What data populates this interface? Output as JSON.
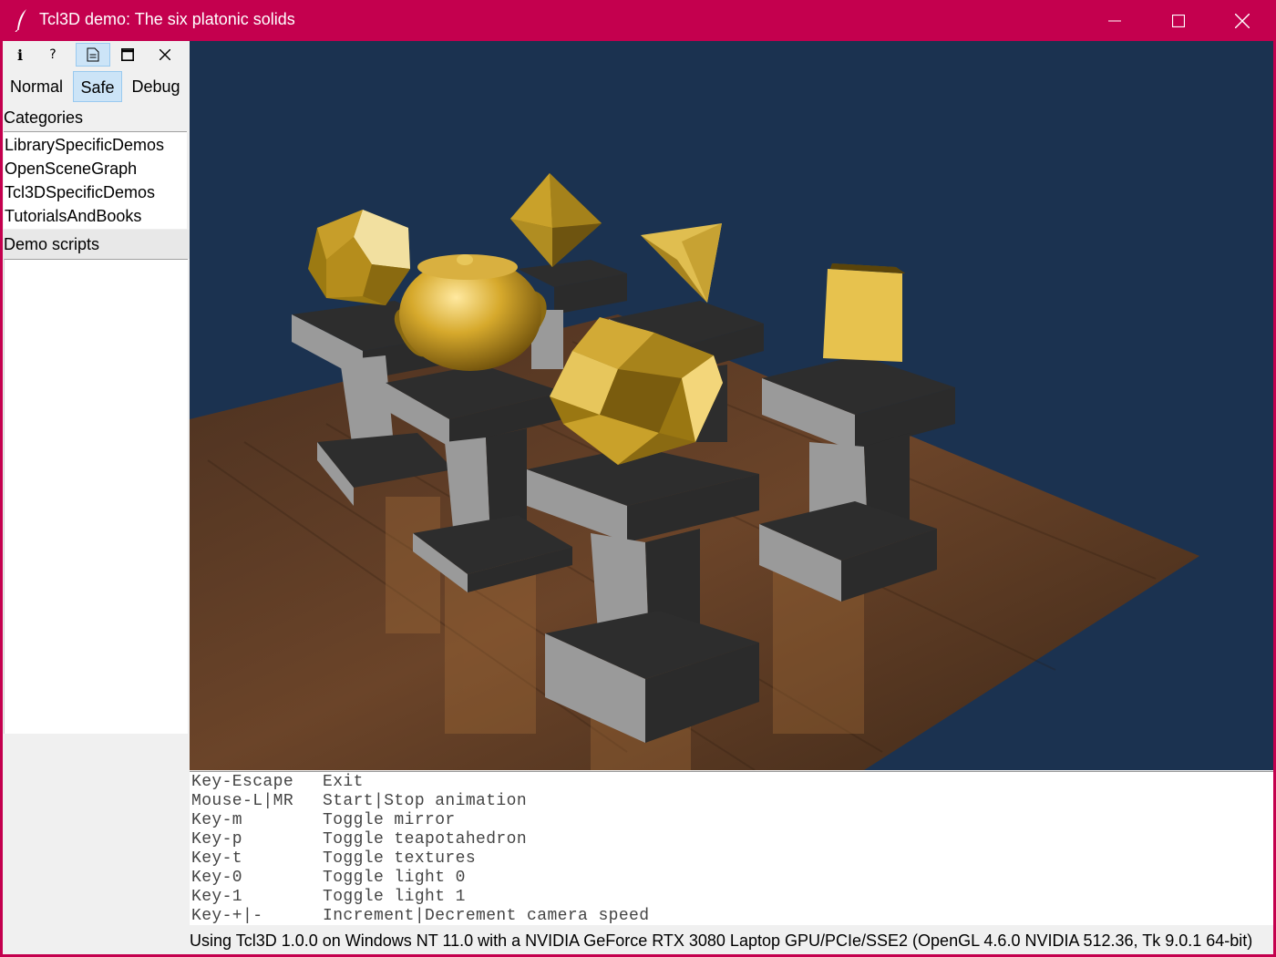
{
  "window": {
    "title": "Tcl3D demo: The six platonic solids",
    "controls": {
      "minimize": "minimize-icon",
      "maximize": "maximize-icon",
      "close": "close-icon"
    }
  },
  "toolbar": {
    "buttons": [
      {
        "icon": "info-icon",
        "glyph": "i"
      },
      {
        "icon": "help-icon",
        "glyph": "?"
      },
      {
        "icon": "document-icon",
        "glyph": "🗎",
        "active": true
      },
      {
        "icon": "window-icon",
        "glyph": "🗖"
      },
      {
        "icon": "close-icon",
        "glyph": "✕"
      }
    ]
  },
  "modes": [
    {
      "label": "Normal",
      "active": false
    },
    {
      "label": "Safe",
      "active": true
    },
    {
      "label": "Debug",
      "active": false
    }
  ],
  "categories": {
    "label": "Categories",
    "items": [
      "LibrarySpecificDemos",
      "OpenSceneGraph",
      "Tcl3DSpecificDemos",
      "TutorialsAndBooks"
    ]
  },
  "scripts": {
    "label": "Demo scripts",
    "items": []
  },
  "help": [
    {
      "key": "Key-Escape",
      "desc": "Exit"
    },
    {
      "key": "Mouse-L|MR",
      "desc": "Start|Stop animation"
    },
    {
      "key": "Key-m",
      "desc": "Toggle mirror"
    },
    {
      "key": "Key-p",
      "desc": "Toggle teapotahedron"
    },
    {
      "key": "Key-t",
      "desc": "Toggle textures"
    },
    {
      "key": "Key-0",
      "desc": "Toggle light 0"
    },
    {
      "key": "Key-1",
      "desc": "Toggle light 1"
    },
    {
      "key": "Key-+|-",
      "desc": "Increment|Decrement camera speed"
    }
  ],
  "status": "Using Tcl3D 1.0.0 on Windows NT 11.0 with a NVIDIA GeForce RTX 3080 Laptop GPU/PCIe/SSE2 (OpenGL 4.6.0 NVIDIA 512.36, Tk 9.0.1 64-bit)",
  "colors": {
    "titlebar": "#c4004e",
    "viewport_bg": "#1b3250",
    "gold": "#c9a12a",
    "pedestal_dark": "#2d2d2d",
    "pedestal_light": "#9a9a9a",
    "table_wood": "#5a3a24"
  }
}
